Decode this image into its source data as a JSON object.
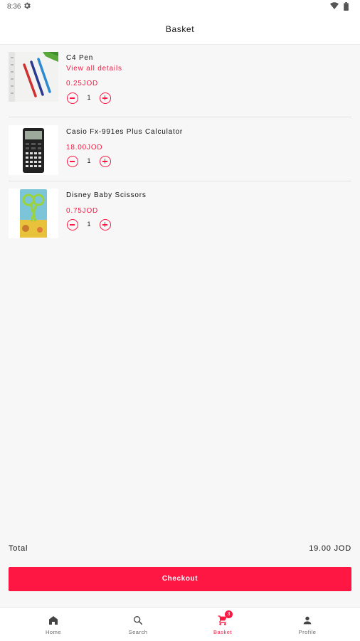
{
  "status_bar": {
    "time": "8:36"
  },
  "app_bar": {
    "title": "Basket"
  },
  "basket": {
    "items": [
      {
        "name": "C4 Pen",
        "details_link": "View all details",
        "price": "0.25JOD",
        "quantity": "1"
      },
      {
        "name": "Casio Fx-991es Plus Calculator",
        "price": "18.00JOD",
        "quantity": "1"
      },
      {
        "name": "Disney Baby Scissors",
        "price": "0.75JOD",
        "quantity": "1"
      }
    ],
    "total_label": "Total",
    "total_value": "19.00 JOD",
    "checkout_label": "Checkout"
  },
  "bottom_nav": {
    "items": [
      {
        "label": "Home",
        "icon": "home-icon"
      },
      {
        "label": "Search",
        "icon": "search-icon"
      },
      {
        "label": "Basket",
        "icon": "cart-icon",
        "badge": "3",
        "active": true
      },
      {
        "label": "Profile",
        "icon": "profile-icon"
      }
    ]
  },
  "colors": {
    "accent": "#ff1744",
    "background": "#f7f7f7"
  }
}
